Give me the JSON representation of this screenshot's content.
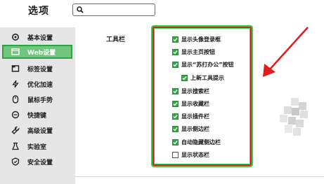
{
  "window": {
    "title": "选项"
  },
  "search": {
    "value": "",
    "placeholder": ""
  },
  "colors": {
    "accent": "#6fc67c",
    "active_border": "#2ca346",
    "highlight_red": "#e41c1c",
    "highlight_green": "#2bd84a",
    "checkbox": "#37a64a"
  },
  "sidebar": {
    "items": [
      {
        "label": "基本设置",
        "icon": "gear-icon",
        "active": false
      },
      {
        "label": "Web设置",
        "icon": "web-icon",
        "active": true
      },
      {
        "label": "标签设置",
        "icon": "tab-icon",
        "active": false
      },
      {
        "label": "优化加速",
        "icon": "lightning-icon",
        "active": false
      },
      {
        "label": "鼠标手势",
        "icon": "mouse-icon",
        "active": false
      },
      {
        "label": "快捷键",
        "icon": "keyboard-icon",
        "active": false
      },
      {
        "label": "高级设置",
        "icon": "wrench-icon",
        "active": false
      },
      {
        "label": "实验室",
        "icon": "flask-icon",
        "active": false
      },
      {
        "label": "安全设置",
        "icon": "shield-icon",
        "active": false
      }
    ]
  },
  "toolbar_group": {
    "label": "工具栏",
    "options": [
      {
        "label": "显示头像登录框",
        "checked": true,
        "indent": false
      },
      {
        "label": "显示主页按钮",
        "checked": true,
        "indent": false
      },
      {
        "label": "显示“苏打办公”按钮",
        "checked": true,
        "indent": false
      },
      {
        "label": "上新工具提示",
        "checked": true,
        "indent": true
      },
      {
        "label": "显示搜索栏",
        "checked": true,
        "indent": false
      },
      {
        "label": "显示收藏栏",
        "checked": true,
        "indent": false
      },
      {
        "label": "显示插件栏",
        "checked": true,
        "indent": false
      },
      {
        "label": "显示侧边栏",
        "checked": true,
        "indent": false
      },
      {
        "label": "自动隐藏侧边栏",
        "checked": true,
        "indent": false
      },
      {
        "label": "显示状态栏",
        "checked": false,
        "indent": false
      }
    ]
  }
}
